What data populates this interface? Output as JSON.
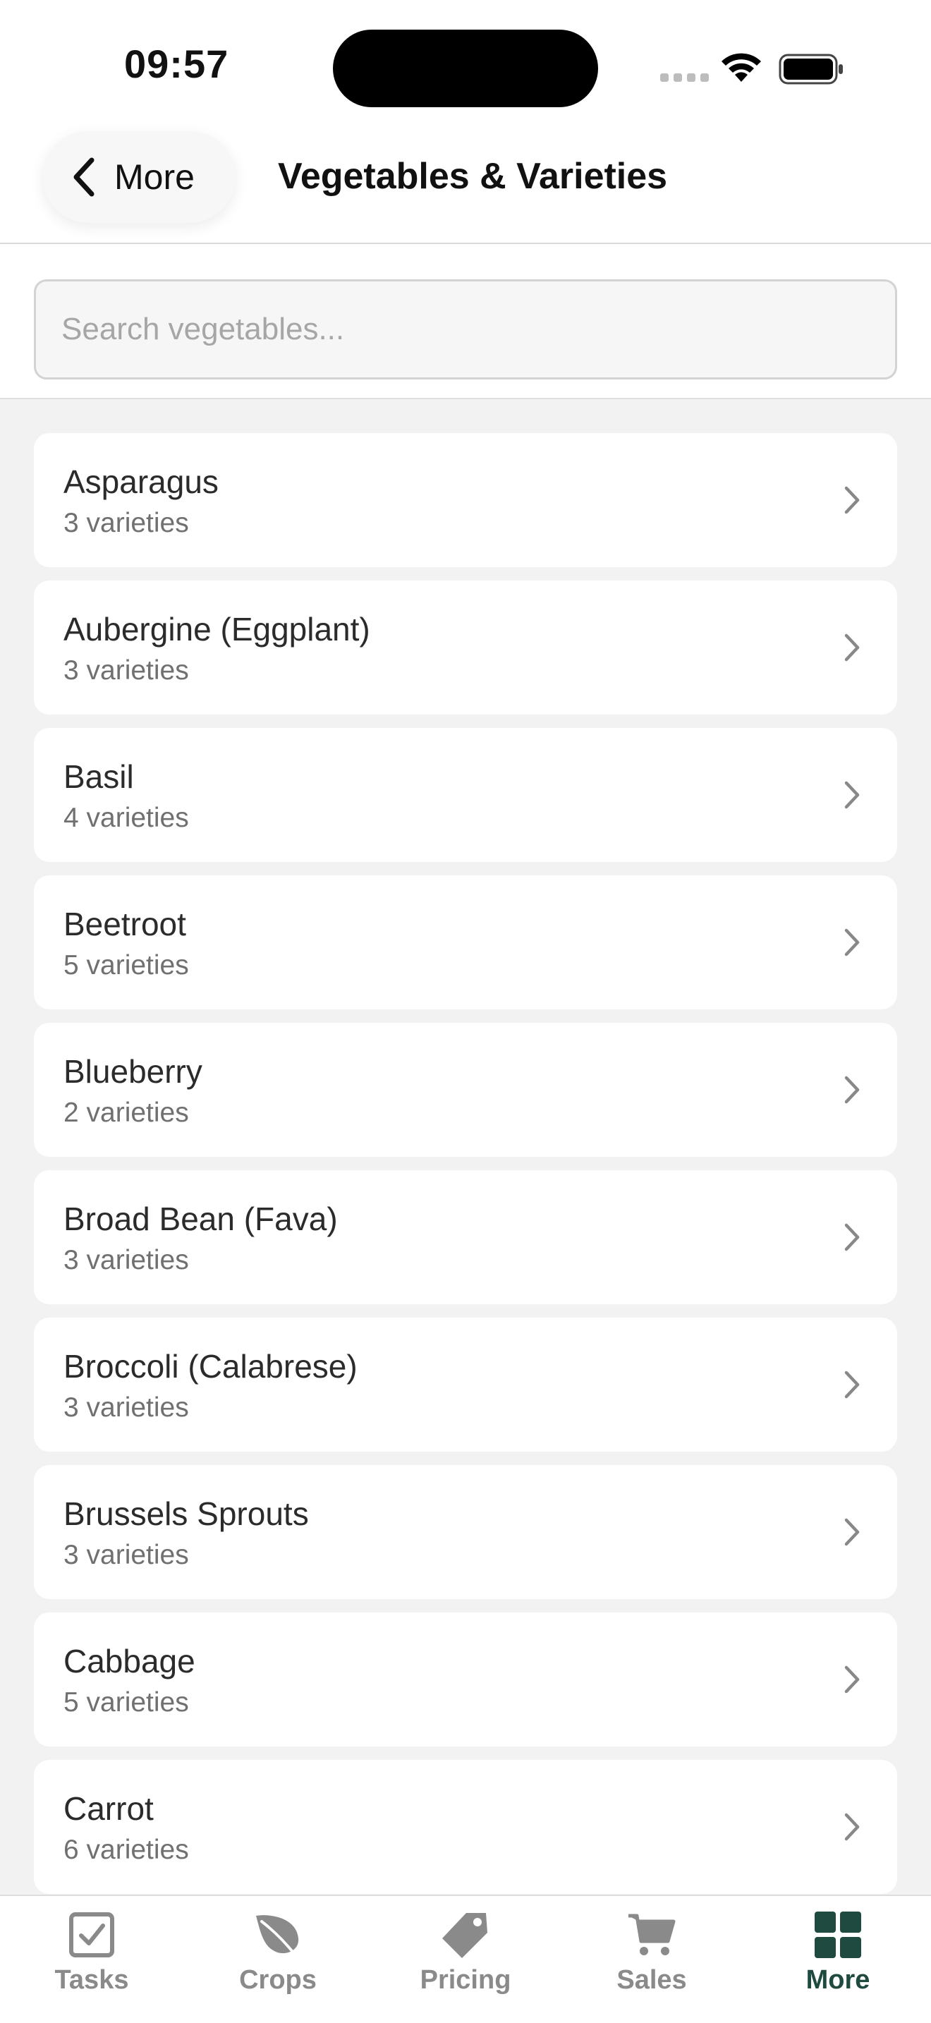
{
  "status_bar": {
    "time": "09:57"
  },
  "header": {
    "back_label": "More",
    "title": "Vegetables & Varieties"
  },
  "search": {
    "placeholder": "Search vegetables...",
    "value": ""
  },
  "vegetables": [
    {
      "name": "Asparagus",
      "count": "3 varieties"
    },
    {
      "name": "Aubergine (Eggplant)",
      "count": "3 varieties"
    },
    {
      "name": "Basil",
      "count": "4 varieties"
    },
    {
      "name": "Beetroot",
      "count": "5 varieties"
    },
    {
      "name": "Blueberry",
      "count": "2 varieties"
    },
    {
      "name": "Broad Bean (Fava)",
      "count": "3 varieties"
    },
    {
      "name": "Broccoli (Calabrese)",
      "count": "3 varieties"
    },
    {
      "name": "Brussels Sprouts",
      "count": "3 varieties"
    },
    {
      "name": "Cabbage",
      "count": "5 varieties"
    },
    {
      "name": "Carrot",
      "count": "6 varieties"
    }
  ],
  "tabs": [
    {
      "label": "Tasks",
      "icon": "checkbox-icon"
    },
    {
      "label": "Crops",
      "icon": "leaf-icon"
    },
    {
      "label": "Pricing",
      "icon": "price-tag-icon"
    },
    {
      "label": "Sales",
      "icon": "cart-icon"
    },
    {
      "label": "More",
      "icon": "grid-icon",
      "active": true
    }
  ],
  "colors": {
    "active_tab": "#1f4a3f",
    "inactive_tab": "#8a8a8a",
    "background": "#f2f2f2"
  }
}
